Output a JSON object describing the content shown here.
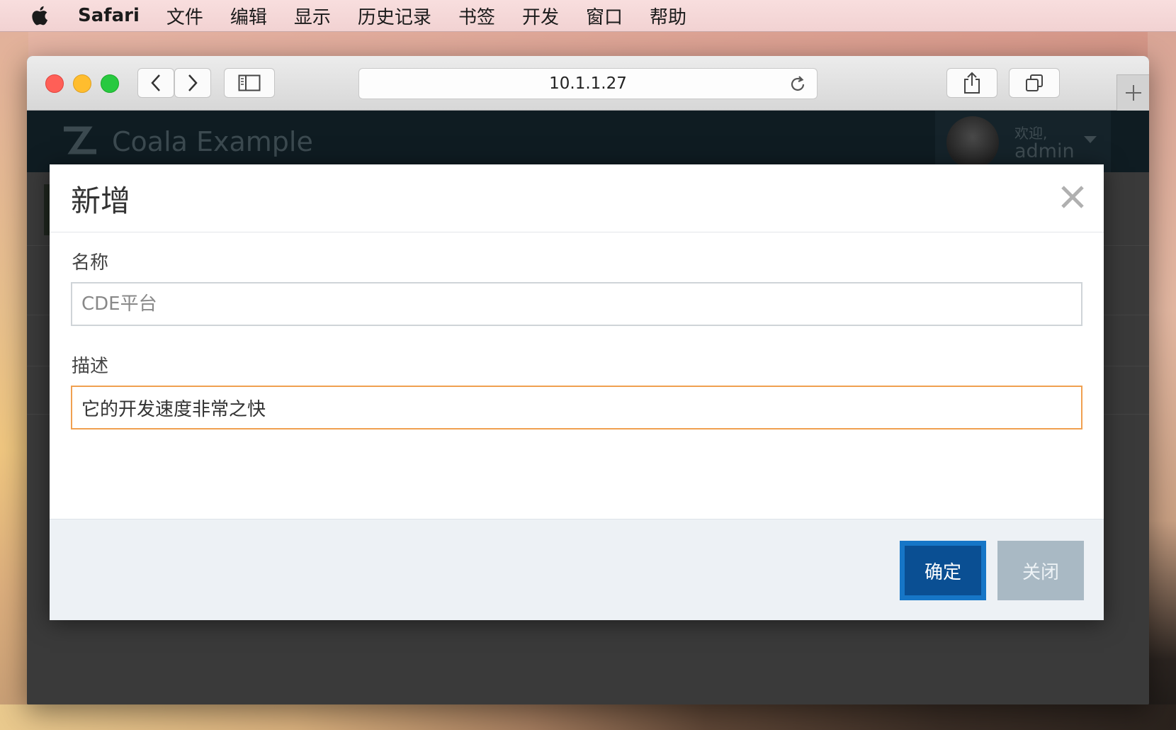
{
  "menubar": {
    "app_name": "Safari",
    "items": [
      "文件",
      "编辑",
      "显示",
      "历史记录",
      "书签",
      "开发",
      "窗口",
      "帮助"
    ]
  },
  "browser": {
    "url": "10.1.1.27"
  },
  "app": {
    "title": "Coala Example",
    "welcome": "欢迎,",
    "username": "admin"
  },
  "modal": {
    "title": "新增",
    "name_label": "名称",
    "name_placeholder": "CDE平台",
    "desc_label": "描述",
    "desc_value": "它的开发速度非常之快",
    "ok_label": "确定",
    "cancel_label": "关闭"
  },
  "colors": {
    "primary": "#0a4f93",
    "focus": "#f0a050",
    "header_bg": "#0f1c22"
  }
}
